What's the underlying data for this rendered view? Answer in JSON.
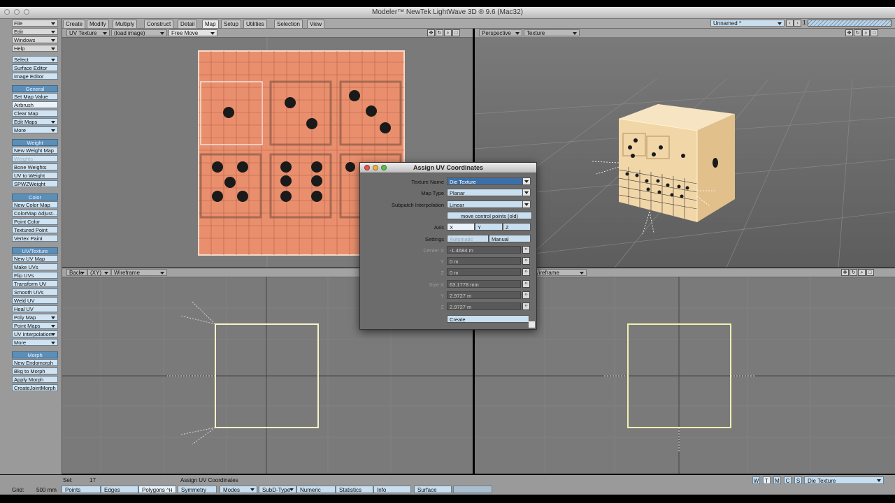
{
  "app": {
    "title": "Modeler™ NewTek LightWave 3D ® 9.6  (Mac32)"
  },
  "menu_tabs": [
    {
      "label": "Create"
    },
    {
      "label": "Modify"
    },
    {
      "label": "Multiply"
    },
    {
      "label": "Construct"
    },
    {
      "label": "Detail"
    },
    {
      "label": "Map"
    },
    {
      "label": "Setup"
    },
    {
      "label": "Utilities"
    },
    {
      "label": "Selection"
    },
    {
      "label": "View"
    }
  ],
  "active_tab": "Map",
  "object_selector": {
    "value": "Unnamed *",
    "layer_number": "1"
  },
  "toolbar": {
    "top": [
      "File",
      "Edit",
      "Windows",
      "Help"
    ],
    "select": "Select",
    "surface_editor": "Surface Editor",
    "image_editor": "Image Editor",
    "general_header": "General",
    "general": [
      "Set Map Value",
      "Airbrush",
      "Clear Map",
      "Edit Maps",
      "More"
    ],
    "weight_header": "Weight",
    "weight": [
      "New Weight Map",
      "Weights",
      "Bone Weights",
      "UV to Weight",
      "SPWZWeight"
    ],
    "color_header": "Color",
    "color": [
      "New Color Map",
      "ColorMap Adjust...",
      "Point Color",
      "Textured Point",
      "Vertex Paint"
    ],
    "uv_header": "UV/Texture",
    "uv": [
      "New UV Map",
      "Make UVs",
      "Flip UVs",
      "Transform UV",
      "Smooth UVs",
      "Weld UV",
      "Heal UV",
      "Poly Map",
      "Point Maps",
      "UV Interpolation",
      "More"
    ],
    "morph_header": "Morph",
    "morph": [
      "New Endomorph",
      "Bkg to Morph",
      "Apply Morph",
      "CreateJointMorph"
    ]
  },
  "viewports": {
    "top_left": {
      "view": "UV Texture",
      "image": "(load image)",
      "mode": "Free Move"
    },
    "top_right": {
      "view": "Perspective",
      "mode": "Texture"
    },
    "bottom_left": {
      "view": "Back",
      "axis": "(XY)",
      "mode": "Wireframe"
    },
    "bottom_right": {
      "mode": "Wireframe"
    }
  },
  "dialog": {
    "title": "Assign UV Coordinates",
    "texture_name_label": "Texture Name",
    "texture_name": "Die Texture",
    "map_type_label": "Map Type",
    "map_type": "Planar",
    "subpatch_label": "Subpatch Interpolation",
    "subpatch": "Linear",
    "move_control_points": "move control points (old)",
    "axis_label": "Axis",
    "axis_x": "X",
    "axis_y": "Y",
    "axis_z": "Z",
    "settings_label": "Settings",
    "settings_auto": "Automatic",
    "settings_manual": "Manual",
    "center_x_label": "Center X",
    "center_x": "-1.4684 m",
    "center_y_label": "Y",
    "center_y": "0 m",
    "center_z_label": "Z",
    "center_z": "0 m",
    "size_x_label": "Size X",
    "size_x": "63.1778 mm",
    "size_y_label": "Y",
    "size_y": "2.9727 m",
    "size_z_label": "Z",
    "size_z": "2.9727 m",
    "create_button": "Create"
  },
  "status": {
    "grid_label": "Grid:",
    "grid_value": "500 mm",
    "sel_label": "Sel:",
    "sel_value": "17",
    "message": "Assign UV Coordinates",
    "buttons": [
      "Points",
      "Edges",
      "Polygons",
      "Symmetry",
      "Modes",
      "SubD-Type",
      "Numeric",
      "Statistics",
      "Info",
      "Surface"
    ],
    "polygons_shortcut": "^H",
    "wtmcs": [
      "W",
      "T",
      "M",
      "C",
      "S"
    ],
    "map_select": "Die Texture"
  },
  "colors": {
    "uv_fill": "#e98f6d",
    "dialog_bg": "#6c6c6c",
    "button_blue": "#c9dff0",
    "header_blue": "#5b8fb8",
    "wireframe_yellow": "#f3efb0",
    "die_face": "#f1d6a8",
    "pip": "#1a1a1a"
  }
}
